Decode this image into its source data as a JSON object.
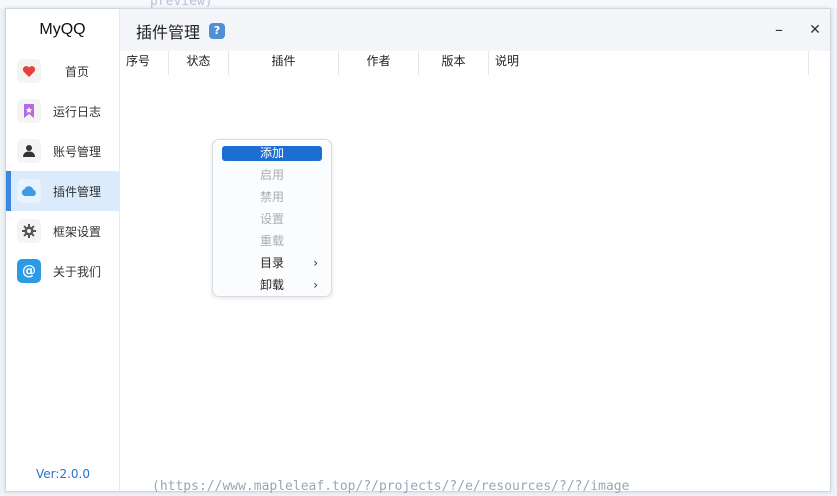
{
  "app": {
    "name": "MyQQ",
    "version": "Ver:2.0.0"
  },
  "background": {
    "text_top": "preview)",
    "text_bottom": "(https://www.mapleleaf.top/?/projects/?/e/resources/?/?/image"
  },
  "sidebar": {
    "items": [
      {
        "label": "首页",
        "icon": "heart-icon",
        "color": "#e8413c",
        "active": false
      },
      {
        "label": "运行日志",
        "icon": "bookmark-icon",
        "color": "#b46be0",
        "active": false
      },
      {
        "label": "账号管理",
        "icon": "user-icon",
        "color": "#333333",
        "active": false
      },
      {
        "label": "插件管理",
        "icon": "cloud-icon",
        "color": "#3d9be8",
        "active": true
      },
      {
        "label": "框架设置",
        "icon": "gear-icon",
        "color": "#555555",
        "active": false
      },
      {
        "label": "关于我们",
        "icon": "at-icon",
        "color": "#2c9be6",
        "active": false
      }
    ]
  },
  "header": {
    "title": "插件管理",
    "help": "?",
    "minimize": "–",
    "close": "✕"
  },
  "table": {
    "columns": [
      "序号",
      "状态",
      "插件",
      "作者",
      "版本",
      "说明"
    ]
  },
  "context_menu": {
    "items": [
      {
        "label": "添加",
        "state": "highlight"
      },
      {
        "label": "启用",
        "state": "disabled"
      },
      {
        "label": "禁用",
        "state": "disabled"
      },
      {
        "label": "设置",
        "state": "disabled"
      },
      {
        "label": "重载",
        "state": "disabled"
      },
      {
        "label": "目录",
        "state": "submenu",
        "arrow": "›"
      },
      {
        "label": "卸载",
        "state": "submenu",
        "arrow": "›"
      }
    ]
  },
  "colors": {
    "accent": "#3a86e0",
    "active_bg": "#dcebfb",
    "menu_highlight": "#1c6fd0"
  }
}
